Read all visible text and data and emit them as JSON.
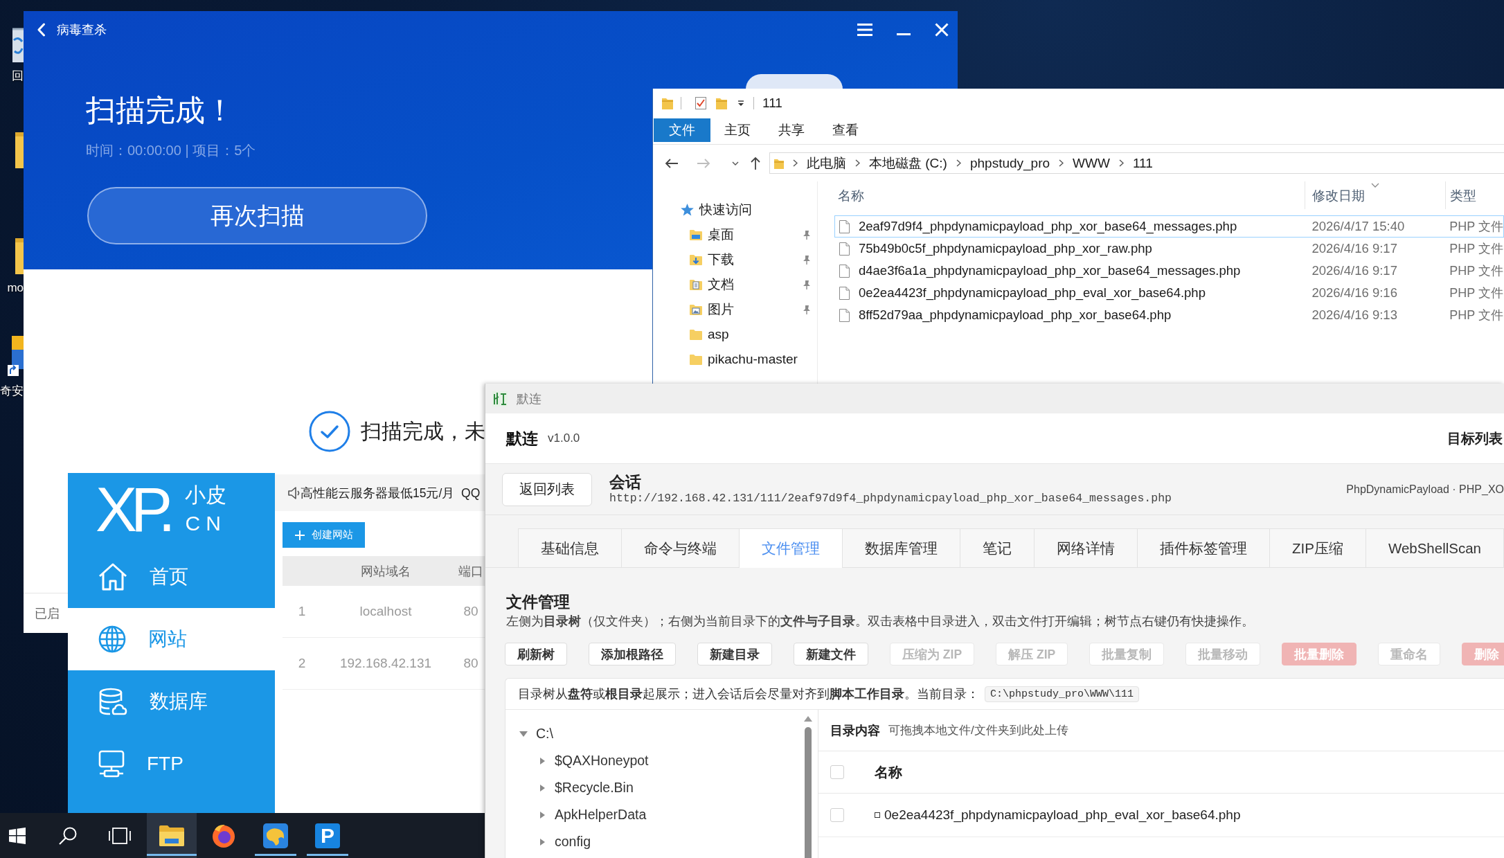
{
  "desktop": {
    "icons": [
      {
        "kind": "recycle-bin",
        "label": "回"
      },
      {
        "kind": "folder"
      },
      {
        "kind": "folder",
        "label": "mo"
      },
      {
        "kind": "shortcut",
        "label": "奇安"
      }
    ]
  },
  "antivirus": {
    "title": "病毒查杀",
    "heading": "扫描完成！",
    "summary": "时间：00:00:00 | 项目：5个",
    "rescan_button": "再次扫描",
    "result": "扫描完成，未",
    "status": "已启"
  },
  "xp_panel": {
    "logo": {
      "mark": "XP.",
      "name": "小皮",
      "domain": "CN"
    },
    "nav": [
      {
        "label": "首页",
        "selected": false
      },
      {
        "label": "网站",
        "selected": true
      },
      {
        "label": "数据库",
        "selected": false
      },
      {
        "label": "FTP",
        "selected": false
      }
    ],
    "notice": "高性能云服务器最低15元/月  QQ",
    "create_button": "创建网站",
    "table": {
      "columns": [
        "网站域名",
        "端口"
      ],
      "rows": [
        {
          "index": "1",
          "domain": "localhost",
          "port": "80"
        },
        {
          "index": "2",
          "domain": "192.168.42.131",
          "port": "80"
        }
      ]
    }
  },
  "explorer": {
    "title": "111",
    "ribbon": [
      {
        "label": "文件",
        "selected": true
      },
      {
        "label": "主页",
        "selected": false
      },
      {
        "label": "共享",
        "selected": false
      },
      {
        "label": "查看",
        "selected": false
      }
    ],
    "path": [
      "此电脑",
      "本地磁盘 (C:)",
      "phpstudy_pro",
      "WWW",
      "111"
    ],
    "nav": [
      {
        "kind": "quick-access",
        "label": "快速访问",
        "pinned": false
      },
      {
        "kind": "desktop",
        "label": "桌面",
        "pinned": true
      },
      {
        "kind": "downloads",
        "label": "下载",
        "pinned": true
      },
      {
        "kind": "documents",
        "label": "文档",
        "pinned": true
      },
      {
        "kind": "pictures",
        "label": "图片",
        "pinned": true
      },
      {
        "kind": "folder",
        "label": "asp",
        "pinned": false
      },
      {
        "kind": "folder",
        "label": "pikachu-master",
        "pinned": false
      }
    ],
    "columns": [
      "名称",
      "修改日期",
      "类型"
    ],
    "files": [
      {
        "name": "2eaf97d9f4_phpdynamicpayload_php_xor_base64_messages.php",
        "modified": "2026/4/17 15:40",
        "type": "PHP 文件",
        "selected": true
      },
      {
        "name": "75b49b0c5f_phpdynamicpayload_php_xor_raw.php",
        "modified": "2026/4/16 9:17",
        "type": "PHP 文件",
        "selected": false
      },
      {
        "name": "d4ae3f6a1a_phpdynamicpayload_php_xor_base64_messages.php",
        "modified": "2026/4/16 9:17",
        "type": "PHP 文件",
        "selected": false
      },
      {
        "name": "0e2ea4423f_phpdynamicpayload_php_eval_xor_base64.php",
        "modified": "2026/4/16 9:16",
        "type": "PHP 文件",
        "selected": false
      },
      {
        "name": "8ff52d79aa_phpdynamicpayload_php_xor_base64.php",
        "modified": "2026/4/16 9:13",
        "type": "PHP 文件",
        "selected": false
      }
    ]
  },
  "webshell": {
    "window_title": "默连",
    "app": "默连",
    "version": "v1.0.0",
    "targets_link": "目标列表",
    "back_button": "返回列表",
    "session": {
      "title": "会话",
      "url": "http://192.168.42.131/111/2eaf97d9f4_phpdynamicpayload_php_xor_base64_messages.php",
      "payload": "PhpDynamicPayload · PHP_XO"
    },
    "tabs": [
      {
        "label": "基础信息",
        "selected": false
      },
      {
        "label": "命令与终端",
        "selected": false
      },
      {
        "label": "文件管理",
        "selected": true
      },
      {
        "label": "数据库管理",
        "selected": false
      },
      {
        "label": "笔记",
        "selected": false
      },
      {
        "label": "网络详情",
        "selected": false
      },
      {
        "label": "插件标签管理",
        "selected": false
      },
      {
        "label": "ZIP压缩",
        "selected": false
      },
      {
        "label": "WebShellScan",
        "selected": false
      }
    ],
    "section": {
      "title": "文件管理",
      "description": "左侧为**目录树**（仅文件夹）；右侧为当前目录下的**文件与子目录**。双击表格中目录进入，双击文件打开编辑；树节点右键仍有快捷操作。"
    },
    "toolbar": [
      {
        "label": "刷新树",
        "kind": "normal",
        "disabled": false
      },
      {
        "label": "添加根路径",
        "kind": "normal",
        "disabled": false
      },
      {
        "label": "新建目录",
        "kind": "normal",
        "disabled": false
      },
      {
        "label": "新建文件",
        "kind": "normal",
        "disabled": false
      },
      {
        "label": "压缩为 ZIP",
        "kind": "normal",
        "disabled": true
      },
      {
        "label": "解压 ZIP",
        "kind": "normal",
        "disabled": true
      },
      {
        "label": "批量复制",
        "kind": "normal",
        "disabled": true
      },
      {
        "label": "批量移动",
        "kind": "normal",
        "disabled": true
      },
      {
        "label": "批量删除",
        "kind": "danger",
        "disabled": true
      },
      {
        "label": "重命名",
        "kind": "normal",
        "disabled": true
      },
      {
        "label": "删除",
        "kind": "danger",
        "disabled": true
      }
    ],
    "info": {
      "text": "目录树从**盘符**或**根目录**起展示；进入会话后会尽量对齐到**脚本工作目录**。当前目录：",
      "current_dir": "C:\\phpstudy_pro\\WWW\\111"
    },
    "tree": [
      {
        "label": "C:\\",
        "expanded": true,
        "children": [
          {
            "label": "$QAXHoneypot",
            "expanded": false
          },
          {
            "label": "$Recycle.Bin",
            "expanded": false
          },
          {
            "label": "ApkHelperData",
            "expanded": false
          },
          {
            "label": "config",
            "expanded": false
          }
        ]
      }
    ],
    "listing": {
      "title": "目录内容",
      "hint": "可拖拽本地文件/文件夹到此处上传",
      "select_all_checked": false,
      "columns": [
        "名称"
      ],
      "rows": [
        {
          "name": "0e2ea4423f_phpdynamicpayload_php_eval_xor_base64.php",
          "checked": false
        }
      ]
    }
  },
  "taskbar": {
    "items": [
      {
        "kind": "start",
        "running": false,
        "active": false
      },
      {
        "kind": "search",
        "running": false,
        "active": false
      },
      {
        "kind": "task-view",
        "running": false,
        "active": false
      },
      {
        "kind": "file-explorer",
        "running": true,
        "active": true
      },
      {
        "kind": "firefox",
        "running": false,
        "active": false
      },
      {
        "kind": "app",
        "running": true,
        "active": false
      },
      {
        "kind": "letter",
        "label": "P",
        "running": true,
        "active": false
      }
    ]
  }
}
